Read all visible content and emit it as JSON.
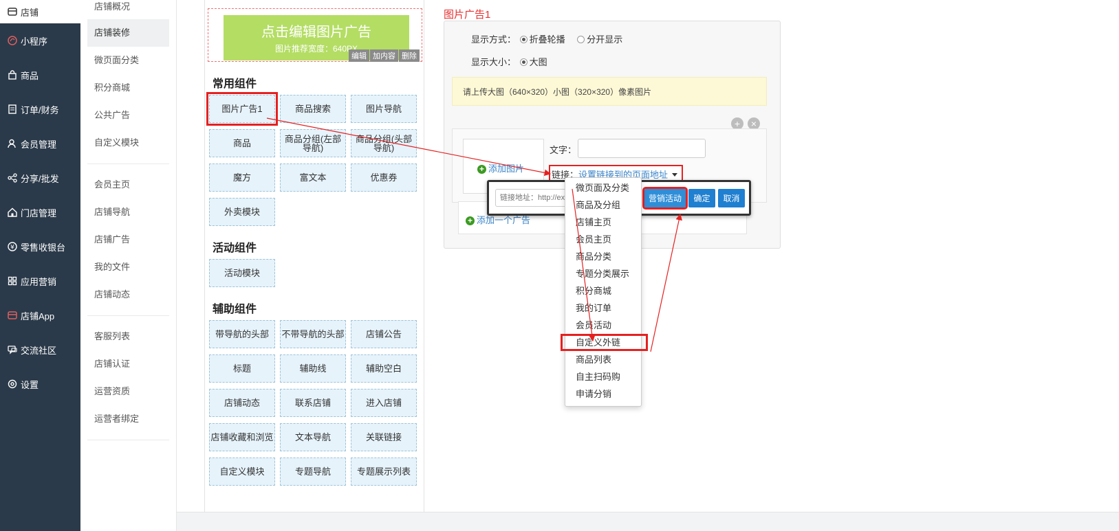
{
  "sidebar": {
    "items": [
      {
        "label": "店铺",
        "icon": "store-icon",
        "active": true
      },
      {
        "label": "小程序",
        "icon": "mini-program-icon"
      },
      {
        "label": "商品",
        "icon": "bag-icon"
      },
      {
        "label": "订单/财务",
        "icon": "order-icon"
      },
      {
        "label": "会员管理",
        "icon": "members-icon"
      },
      {
        "label": "分享/批发",
        "icon": "share-icon"
      },
      {
        "label": "门店管理",
        "icon": "house-icon"
      },
      {
        "label": "零售收银台",
        "icon": "cashier-icon"
      },
      {
        "label": "应用营销",
        "icon": "apps-icon"
      },
      {
        "label": "店铺App",
        "icon": "app-icon"
      },
      {
        "label": "交流社区",
        "icon": "chat-icon"
      },
      {
        "label": "设置",
        "icon": "gear-icon"
      }
    ]
  },
  "submenu": {
    "group1": [
      "店铺概况",
      "店铺装修",
      "微页面分类",
      "积分商城",
      "公共广告",
      "自定义模块"
    ],
    "group2": [
      "会员主页",
      "店铺导航",
      "店铺广告",
      "我的文件",
      "店铺动态"
    ],
    "group3": [
      "客服列表",
      "店铺认证",
      "运营资质",
      "运营者绑定"
    ],
    "active": "店铺装修"
  },
  "preview": {
    "title": "点击编辑图片广告",
    "hint": "图片推荐宽度：640PX",
    "ops": [
      "编辑",
      "加内容",
      "删除"
    ]
  },
  "library": {
    "common_title": "常用组件",
    "common": [
      "图片广告1",
      "商品搜索",
      "图片导航",
      "商品",
      "商品分组(左部导航)",
      "商品分组(头部导航)",
      "魔方",
      "富文本",
      "优惠券",
      "外卖模块"
    ],
    "activity_title": "活动组件",
    "activity": [
      "活动模块"
    ],
    "aux_title": "辅助组件",
    "aux": [
      "带导航的头部",
      "不带导航的头部",
      "店铺公告",
      "标题",
      "辅助线",
      "辅助空白",
      "店铺动态",
      "联系店铺",
      "进入店铺",
      "店铺收藏和浏览",
      "文本导航",
      "关联链接",
      "自定义模块",
      "专题导航",
      "专题展示列表"
    ]
  },
  "editor": {
    "title": "图片广告1",
    "display_mode_label": "显示方式：",
    "display_mode_options": [
      "折叠轮播",
      "分开显示"
    ],
    "display_mode_selected": "折叠轮播",
    "display_size_label": "显示大小：",
    "display_size_option": "大图",
    "notice": "请上传大图（640×320）小图（320×320）像素图片",
    "add_image": "添加图片",
    "text_label": "文字：",
    "text_value": "",
    "link_label": "链接：",
    "link_value": "设置链接到的页面地址",
    "add_ad": "添加一个广告"
  },
  "link_popup": {
    "placeholder": "链接地址：http://ex",
    "marketing_button": "营销活动",
    "ok_button": "确定",
    "cancel_button": "取消"
  },
  "dropdown": {
    "items": [
      "微页面及分类",
      "商品及分组",
      "店铺主页",
      "会员主页",
      "商品分类",
      "专题分类展示",
      "积分商城",
      "我的订单",
      "会员活动",
      "自定义外链",
      "商品列表",
      "自主扫码购",
      "申请分销"
    ],
    "highlighted": "自定义外链"
  },
  "colors": {
    "sidebar_bg": "#2b3a4a",
    "highlight_red": "#e62020",
    "link_blue": "#3883c9",
    "ad_green": "#b4dd64"
  }
}
